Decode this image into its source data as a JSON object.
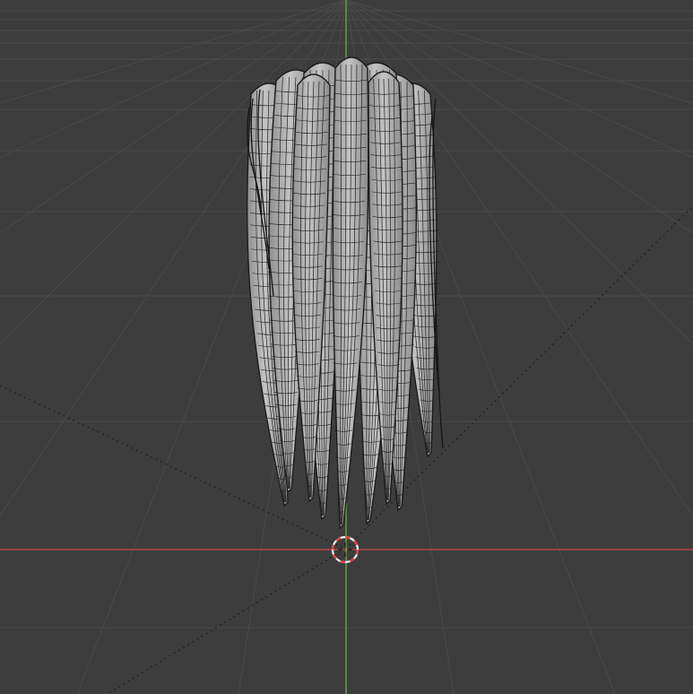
{
  "viewport": {
    "view": "3d-viewport",
    "object": "hair-mesh",
    "display_mode": "wireframe-overlay",
    "colors": {
      "background": "#3d3d3d",
      "grid_line": "#4a4a4a",
      "x_axis": "#d14a4a",
      "y_axis": "#6aa84f",
      "mesh_fill": "#b7b7b7",
      "mesh_shadow": "#8e8e8e",
      "wire": "#1b1b1b",
      "cursor_red": "#e0413b",
      "cursor_white": "#f2f2f2"
    },
    "icons": [
      "3d-cursor-icon"
    ]
  }
}
